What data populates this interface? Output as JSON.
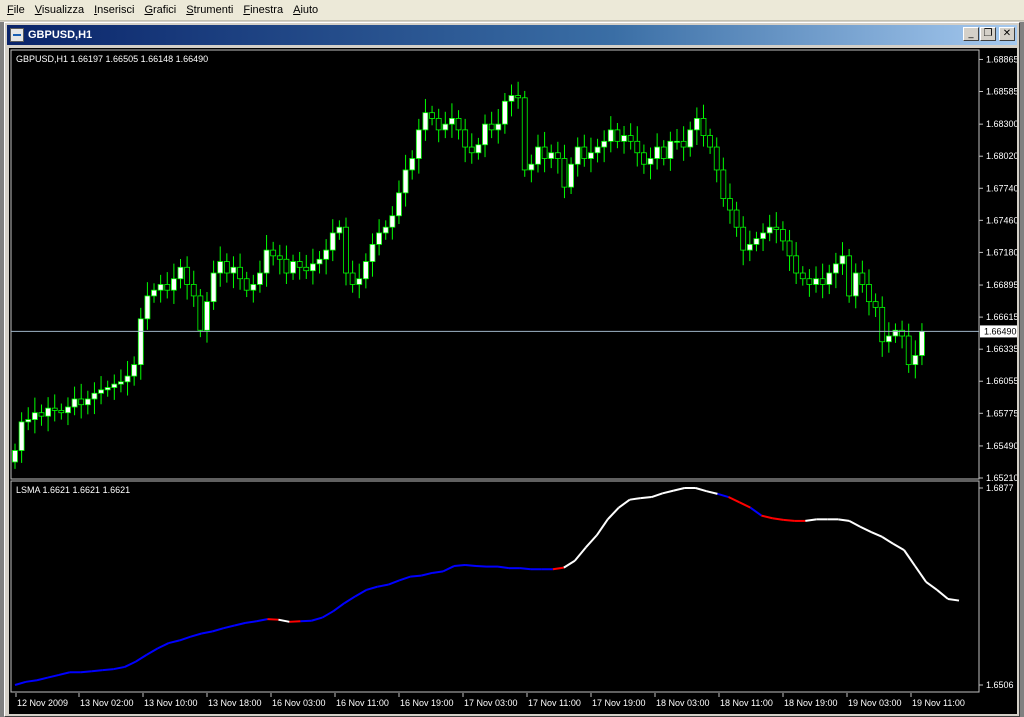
{
  "menu": [
    {
      "label": "File",
      "u": "F",
      "rest": "ile"
    },
    {
      "label": "Visualizza",
      "u": "V",
      "rest": "isualizza"
    },
    {
      "label": "Inserisci",
      "u": "I",
      "rest": "nserisci"
    },
    {
      "label": "Grafici",
      "u": "G",
      "rest": "rafici"
    },
    {
      "label": "Strumenti",
      "u": "S",
      "rest": "trumenti"
    },
    {
      "label": "Finestra",
      "u": "F",
      "rest": "inestra"
    },
    {
      "label": "Aiuto",
      "u": "A",
      "rest": "iuto"
    }
  ],
  "window": {
    "title": "GBPUSD,H1",
    "minimize_glyph": "_",
    "restore_glyph": "❐",
    "close_glyph": "✕"
  },
  "price_panel": {
    "info": "GBPUSD,H1  1.66197 1.66505 1.66148 1.66490",
    "y_ticks": [
      "1.68865",
      "1.68585",
      "1.68300",
      "1.68020",
      "1.67740",
      "1.67460",
      "1.67180",
      "1.66895",
      "1.66615",
      "1.66335",
      "1.66055",
      "1.65775",
      "1.65490",
      "1.65210"
    ],
    "current_price": "1.66490",
    "ylim": [
      1.6521,
      1.6893
    ]
  },
  "indicator_panel": {
    "info": "LSMA 1.6621 1.6621 1.6621",
    "y_top": "1.6877",
    "y_bottom": "1.6506"
  },
  "x_ticks": [
    "12 Nov 2009",
    "13 Nov 02:00",
    "13 Nov 10:00",
    "13 Nov 18:00",
    "16 Nov 03:00",
    "16 Nov 11:00",
    "16 Nov 19:00",
    "17 Nov 03:00",
    "17 Nov 11:00",
    "17 Nov 19:00",
    "18 Nov 03:00",
    "18 Nov 11:00",
    "18 Nov 19:00",
    "19 Nov 03:00",
    "19 Nov 11:00"
  ],
  "colors": {
    "bull": "#ffffff",
    "bear": "#000000",
    "wick": "#00ff00",
    "lsma_up": "#0000ff",
    "lsma_flat": "#ffffff",
    "lsma_turn": "#ff0000",
    "grid_line": "#9fb4c7"
  },
  "chart_data": {
    "type": "candlestick",
    "symbol": "GBPUSD",
    "timeframe": "H1",
    "close": [
      1.6545,
      1.657,
      1.6572,
      1.6578,
      1.6575,
      1.6582,
      1.658,
      1.6578,
      1.6583,
      1.659,
      1.6585,
      1.659,
      1.6595,
      1.6598,
      1.66,
      1.6603,
      1.6605,
      1.661,
      1.662,
      1.666,
      1.668,
      1.6685,
      1.669,
      1.6685,
      1.6695,
      1.6705,
      1.669,
      1.668,
      1.665,
      1.6675,
      1.67,
      1.671,
      1.67,
      1.6705,
      1.6695,
      1.6685,
      1.669,
      1.67,
      1.672,
      1.6715,
      1.6712,
      1.67,
      1.671,
      1.6705,
      1.6702,
      1.6708,
      1.6712,
      1.672,
      1.6735,
      1.674,
      1.67,
      1.669,
      1.6695,
      1.671,
      1.6725,
      1.6735,
      1.674,
      1.675,
      1.677,
      1.679,
      1.68,
      1.6825,
      1.684,
      1.6835,
      1.6825,
      1.683,
      1.6835,
      1.6825,
      1.681,
      1.6805,
      1.6812,
      1.683,
      1.6825,
      1.683,
      1.685,
      1.6855,
      1.6853,
      1.679,
      1.6795,
      1.681,
      1.68,
      1.6805,
      1.68,
      1.6775,
      1.6795,
      1.681,
      1.68,
      1.6805,
      1.681,
      1.6815,
      1.6825,
      1.6815,
      1.682,
      1.6815,
      1.6805,
      1.6795,
      1.68,
      1.681,
      1.68,
      1.6815,
      1.6815,
      1.681,
      1.6825,
      1.6835,
      1.682,
      1.681,
      1.679,
      1.6765,
      1.6755,
      1.674,
      1.672,
      1.6725,
      1.673,
      1.6735,
      1.674,
      1.6738,
      1.6728,
      1.6715,
      1.67,
      1.6695,
      1.669,
      1.6695,
      1.669,
      1.67,
      1.6708,
      1.6715,
      1.668,
      1.67,
      1.669,
      1.6675,
      1.667,
      1.664,
      1.6645,
      1.665,
      1.6645,
      1.662,
      1.6628,
      1.6649
    ]
  },
  "lsma_data": {
    "values": [
      1.6506,
      1.6512,
      1.6515,
      1.652,
      1.6525,
      1.653,
      1.653,
      1.6532,
      1.6534,
      1.6536,
      1.654,
      1.655,
      1.6563,
      1.6575,
      1.6585,
      1.659,
      1.6597,
      1.6603,
      1.6607,
      1.6613,
      1.6618,
      1.6623,
      1.6626,
      1.663,
      1.6629,
      1.6625,
      1.6626,
      1.6627,
      1.6633,
      1.6645,
      1.666,
      1.6673,
      1.6685,
      1.6691,
      1.6695,
      1.6703,
      1.671,
      1.6712,
      1.6717,
      1.672,
      1.673,
      1.6732,
      1.673,
      1.6729,
      1.6729,
      1.6726,
      1.6726,
      1.6724,
      1.6724,
      1.6724,
      1.6727,
      1.674,
      1.6765,
      1.6788,
      1.6818,
      1.684,
      1.6855,
      1.6858,
      1.686,
      1.6867,
      1.6872,
      1.6877,
      1.6877,
      1.6871,
      1.6866,
      1.686,
      1.685,
      1.684,
      1.6825,
      1.682,
      1.6817,
      1.6815,
      1.6815,
      1.6818,
      1.6818,
      1.6818,
      1.6815,
      1.6804,
      1.6794,
      1.6785,
      1.6772,
      1.676,
      1.673,
      1.67,
      1.6685,
      1.6668,
      1.6665
    ],
    "colors": [
      "up",
      "up",
      "up",
      "up",
      "up",
      "up",
      "up",
      "up",
      "up",
      "up",
      "up",
      "up",
      "up",
      "up",
      "up",
      "up",
      "up",
      "up",
      "up",
      "up",
      "up",
      "up",
      "up",
      "turn",
      "flat",
      "turn",
      "up",
      "up",
      "up",
      "up",
      "up",
      "up",
      "up",
      "up",
      "up",
      "up",
      "up",
      "up",
      "up",
      "up",
      "up",
      "up",
      "up",
      "up",
      "up",
      "up",
      "up",
      "up",
      "up",
      "turn",
      "flat",
      "flat",
      "flat",
      "flat",
      "flat",
      "flat",
      "flat",
      "flat",
      "flat",
      "flat",
      "flat",
      "flat",
      "flat",
      "flat",
      "up",
      "turn",
      "turn",
      "up",
      "turn",
      "turn",
      "turn",
      "turn",
      "flat",
      "flat",
      "flat",
      "flat",
      "flat",
      "flat",
      "flat",
      "flat",
      "flat",
      "flat",
      "flat",
      "flat",
      "flat",
      "flat",
      "flat"
    ]
  }
}
